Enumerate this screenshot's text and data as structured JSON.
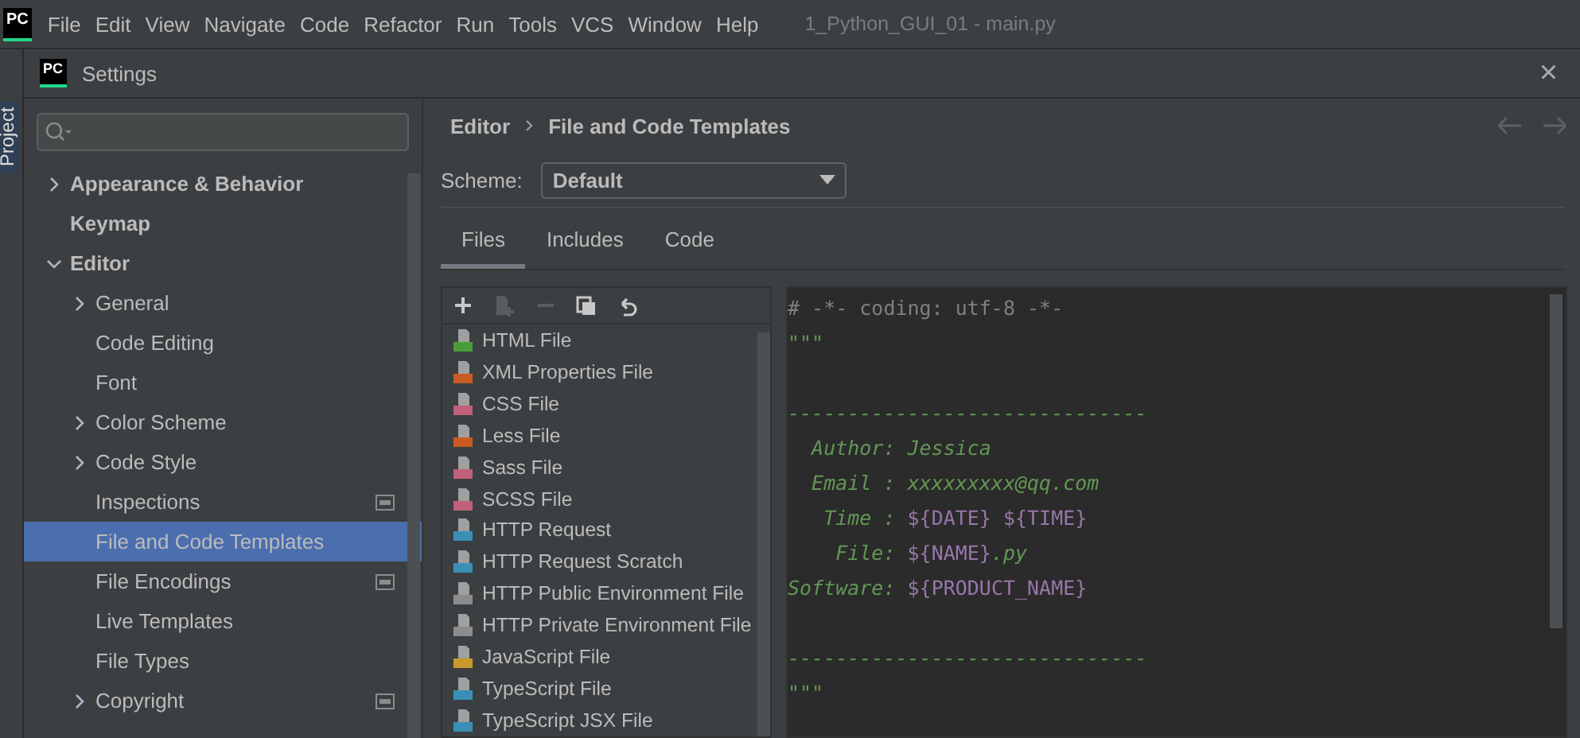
{
  "menu_bar": {
    "logo": "PC",
    "items": [
      "File",
      "Edit",
      "View",
      "Navigate",
      "Code",
      "Refactor",
      "Run",
      "Tools",
      "VCS",
      "Window",
      "Help"
    ],
    "project_title": "1_Python_GUI_01 - main.py"
  },
  "tool_strip": {
    "label": "Project"
  },
  "dialog": {
    "logo": "PC",
    "title": "Settings",
    "close": "×"
  },
  "sidebar": {
    "items": [
      {
        "label": "Appearance & Behavior",
        "expandable": true,
        "expanded": false,
        "selected": false,
        "badge": false
      },
      {
        "label": "Keymap",
        "expandable": false,
        "selected": false,
        "badge": false
      },
      {
        "label": "Editor",
        "expandable": true,
        "expanded": true,
        "selected": false,
        "badge": false,
        "children": [
          {
            "label": "General",
            "expandable": true,
            "selected": false,
            "badge": false
          },
          {
            "label": "Code Editing",
            "expandable": false,
            "selected": false,
            "badge": false
          },
          {
            "label": "Font",
            "expandable": false,
            "selected": false,
            "badge": false
          },
          {
            "label": "Color Scheme",
            "expandable": true,
            "selected": false,
            "badge": false
          },
          {
            "label": "Code Style",
            "expandable": true,
            "selected": false,
            "badge": false
          },
          {
            "label": "Inspections",
            "expandable": false,
            "selected": false,
            "badge": true
          },
          {
            "label": "File and Code Templates",
            "expandable": false,
            "selected": true,
            "badge": false
          },
          {
            "label": "File Encodings",
            "expandable": false,
            "selected": false,
            "badge": true
          },
          {
            "label": "Live Templates",
            "expandable": false,
            "selected": false,
            "badge": false
          },
          {
            "label": "File Types",
            "expandable": false,
            "selected": false,
            "badge": false
          },
          {
            "label": "Copyright",
            "expandable": true,
            "selected": false,
            "badge": true
          }
        ]
      }
    ]
  },
  "breadcrumb": [
    "Editor",
    "File and Code Templates"
  ],
  "scheme": {
    "label": "Scheme:",
    "value": "Default"
  },
  "tabs": [
    {
      "label": "Files",
      "selected": true
    },
    {
      "label": "Includes",
      "selected": false
    },
    {
      "label": "Code",
      "selected": false
    }
  ],
  "templates": [
    {
      "label": "HTML File",
      "color": "#4a9c3b"
    },
    {
      "label": "XML Properties File",
      "color": "#c95b22"
    },
    {
      "label": "CSS File",
      "color": "#c0607a"
    },
    {
      "label": "Less File",
      "color": "#c95b22"
    },
    {
      "label": "Sass File",
      "color": "#c0607a"
    },
    {
      "label": "SCSS File",
      "color": "#c0607a"
    },
    {
      "label": "HTTP Request",
      "color": "#3a8fb7"
    },
    {
      "label": "HTTP Request Scratch",
      "color": "#3a8fb7"
    },
    {
      "label": "HTTP Public Environment File",
      "color": "#8c8c8c"
    },
    {
      "label": "HTTP Private Environment File",
      "color": "#8c8c8c"
    },
    {
      "label": "JavaScript File",
      "color": "#c9992b"
    },
    {
      "label": "TypeScript File",
      "color": "#3a8fb7"
    },
    {
      "label": "TypeScript JSX File",
      "color": "#3a8fb7"
    }
  ],
  "template_code": [
    {
      "kind": "code",
      "segments": [
        {
          "kind": "comment",
          "text": "# -*- coding: utf-8 -*-"
        }
      ]
    },
    {
      "kind": "code",
      "segments": [
        {
          "kind": "string",
          "text": "\"\"\""
        }
      ]
    },
    {
      "kind": "blank"
    },
    {
      "kind": "code",
      "segments": [
        {
          "kind": "string",
          "text": "------------------------------"
        }
      ]
    },
    {
      "kind": "code",
      "segments": [
        {
          "kind": "string",
          "text": "  Author: Jessica"
        }
      ]
    },
    {
      "kind": "code",
      "segments": [
        {
          "kind": "string",
          "text": "  Email : xxxxxxxxx@qq.com"
        }
      ]
    },
    {
      "kind": "code",
      "segments": [
        {
          "kind": "string",
          "text": "   Time : "
        },
        {
          "kind": "var",
          "text": "${DATE} ${TIME}"
        }
      ]
    },
    {
      "kind": "code",
      "segments": [
        {
          "kind": "string",
          "text": "    File: "
        },
        {
          "kind": "var",
          "text": "${NAME}"
        },
        {
          "kind": "string",
          "text": ".py"
        }
      ]
    },
    {
      "kind": "code",
      "segments": [
        {
          "kind": "string",
          "text": "Software: "
        },
        {
          "kind": "var",
          "text": "${PRODUCT_NAME}"
        }
      ]
    },
    {
      "kind": "blank"
    },
    {
      "kind": "code",
      "segments": [
        {
          "kind": "string",
          "text": "------------------------------"
        }
      ]
    },
    {
      "kind": "code",
      "segments": [
        {
          "kind": "string",
          "text": "\"\"\""
        }
      ]
    }
  ]
}
